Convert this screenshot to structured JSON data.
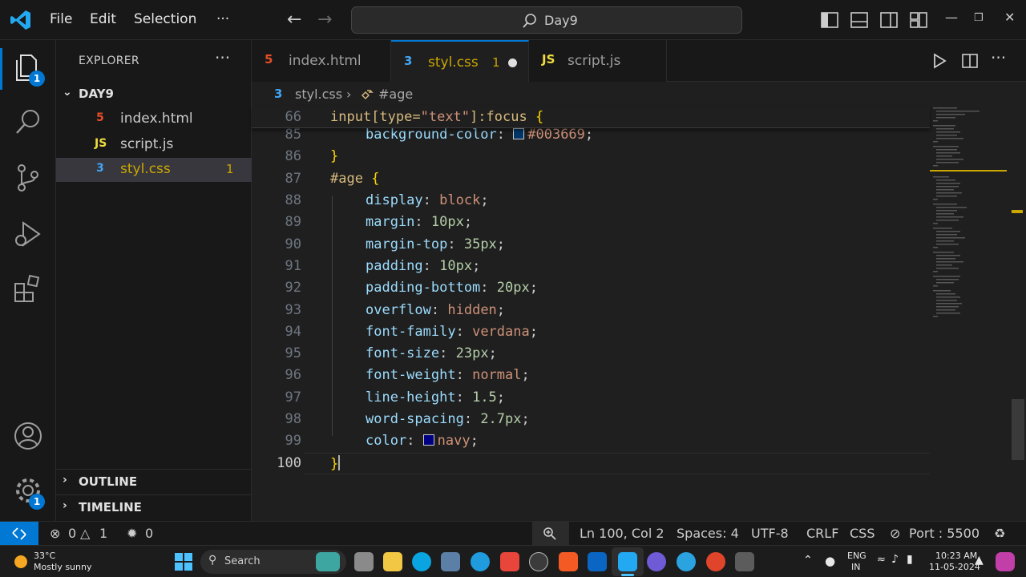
{
  "titlebar": {
    "menu": [
      "File",
      "Edit",
      "Selection",
      "···"
    ],
    "search_text": "Day9",
    "window_controls": [
      "—",
      "❒",
      "✕"
    ]
  },
  "activity": {
    "explorer_badge": "1",
    "settings_badge": "1",
    "accent": "#0078d4"
  },
  "explorer": {
    "title": "EXPLORER",
    "more": "···",
    "folder": "DAY9",
    "files": [
      {
        "name": "index.html",
        "icon": "5",
        "count": ""
      },
      {
        "name": "script.js",
        "icon": "JS",
        "count": ""
      },
      {
        "name": "styl.css",
        "icon": "3",
        "count": "1"
      }
    ],
    "sections": [
      "OUTLINE",
      "TIMELINE"
    ]
  },
  "tabs": [
    {
      "label": "index.html",
      "icon": "5"
    },
    {
      "label": "styl.css",
      "icon": "3",
      "count": "1"
    },
    {
      "label": "script.js",
      "icon": "JS"
    }
  ],
  "breadcrumb": {
    "file": "styl.css",
    "sep": "›",
    "symbol": "#age"
  },
  "editor": {
    "sticky_line_number": "66",
    "line_numbers": [
      "85",
      "86",
      "87",
      "88",
      "89",
      "90",
      "91",
      "92",
      "93",
      "94",
      "95",
      "96",
      "97",
      "98",
      "99",
      "100"
    ],
    "lines": [
      {
        "prop": "background-color",
        "val": "#003669",
        "swatch": "#003669"
      },
      {
        "prop": "display",
        "val": "block"
      },
      {
        "prop": "margin",
        "val": "10px"
      },
      {
        "prop": "margin-top",
        "val": "35px"
      },
      {
        "prop": "padding",
        "val": "10px"
      },
      {
        "prop": "padding-bottom",
        "val": "20px"
      },
      {
        "prop": "overflow",
        "val": "hidden"
      },
      {
        "prop": "font-family",
        "val": "verdana"
      },
      {
        "prop": "font-size",
        "val": "23px"
      },
      {
        "prop": "font-weight",
        "val": "normal"
      },
      {
        "prop": "line-height",
        "val": "1.5"
      },
      {
        "prop": "word-spacing",
        "val": "2.7px"
      },
      {
        "prop": "color",
        "val": "navy",
        "swatch": "#000080"
      }
    ],
    "sticky_selector": "input",
    "sticky_attr": "[type=",
    "sticky_str": "\"text\"",
    "sticky_rest": "]:focus",
    "selector": "#age",
    "open_brace": "{",
    "close_brace": "}"
  },
  "status": {
    "errors": "0",
    "warnings": "1",
    "ports_count": "0",
    "cursor": "Ln 100, Col 2",
    "spaces": "Spaces: 4",
    "encoding": "UTF-8",
    "eol": "CRLF",
    "language": "CSS",
    "port": "Port : 5500"
  },
  "taskbar": {
    "temperature": "33°C",
    "weather": "Mostly sunny",
    "search": "Search",
    "lang1": "ENG",
    "lang2": "IN",
    "time": "10:23 AM",
    "date": "11-05-2024"
  }
}
